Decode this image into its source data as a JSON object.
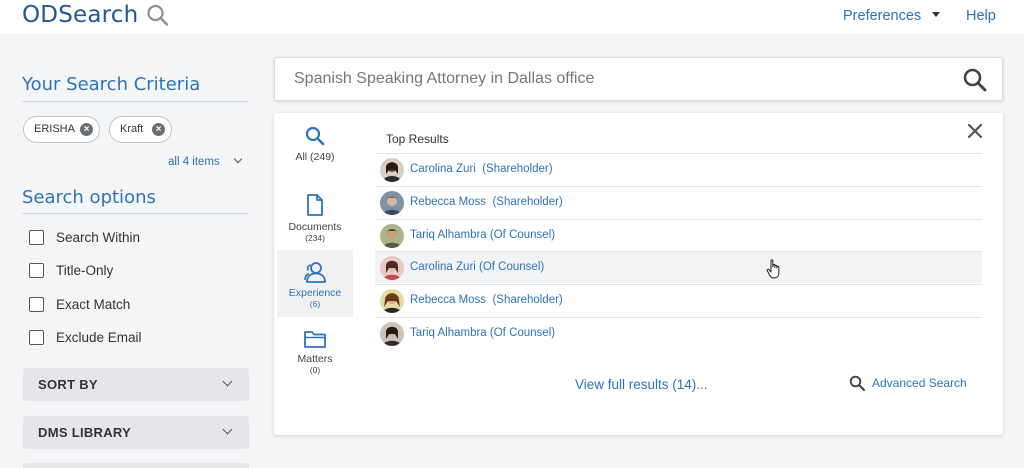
{
  "header": {
    "logo_text": "ODSearch",
    "logo_icon": "search-icon",
    "preferences_label": "Preferences",
    "help_label": "Help",
    "accent_color": "#2e73b8",
    "brand_color": "#1f5a91"
  },
  "sidebar": {
    "criteria_title": "Your Search Criteria",
    "chips": [
      {
        "label": "ERISHA"
      },
      {
        "label": "Kraft"
      }
    ],
    "all_items_label": "all 4 items",
    "options_title": "Search options",
    "options": [
      {
        "label": "Search Within",
        "checked": false
      },
      {
        "label": "Title-Only",
        "checked": false
      },
      {
        "label": "Exact Match",
        "checked": false
      },
      {
        "label": "Exclude Email",
        "checked": false
      }
    ],
    "accordions": [
      {
        "label": "SORT BY"
      },
      {
        "label": "DMS LIBRARY"
      }
    ]
  },
  "search": {
    "value": "Spanish Speaking Attorney in Dallas office"
  },
  "results": {
    "tabs": [
      {
        "label": "All",
        "count": "(249)",
        "label_full": "All (249)",
        "icon": "search-icon",
        "active": false
      },
      {
        "label": "Documents",
        "count": "(234)",
        "icon": "document-icon",
        "active": false
      },
      {
        "label": "Experience",
        "count": "(6)",
        "icon": "people-icon",
        "active": true
      },
      {
        "label": "Matters",
        "count": "(0)",
        "icon": "folder-icon",
        "active": false
      }
    ],
    "heading": "Top Results",
    "rows": [
      {
        "name": "Carolina Zuri  (Shareholder)",
        "avatar_color": "#6b4a3a"
      },
      {
        "name": "Rebecca Moss  (Shareholder)",
        "avatar_color": "#5a6a7a"
      },
      {
        "name": "Tariq Alhambra (Of Counsel)",
        "avatar_color": "#8a7a5a"
      },
      {
        "name": "Carolina Zuri (Of Counsel)",
        "avatar_color": "#c98a8a"
      },
      {
        "name": "Rebecca Moss  (Shareholder)",
        "avatar_color": "#b8894a"
      },
      {
        "name": "Tariq Alhambra (Of Counsel)",
        "avatar_color": "#5a3a3a"
      }
    ],
    "view_full_label": "View full results (14)...",
    "advanced_search_label": "Advanced Search"
  }
}
